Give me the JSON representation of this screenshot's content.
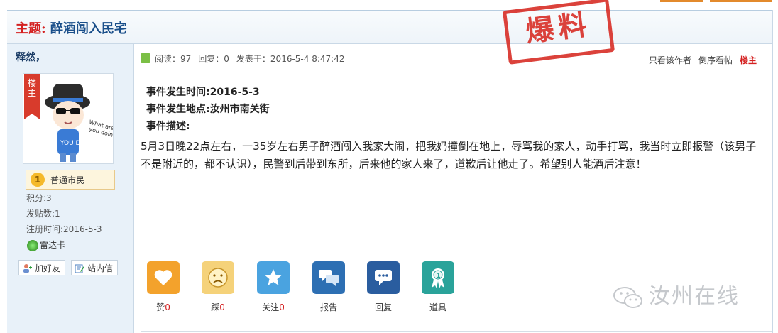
{
  "header": {
    "label": "主题:",
    "title": "醉酒闯入民宅",
    "stamp": "爆料"
  },
  "sidebar": {
    "username": "释然，",
    "ribbon": "楼主",
    "rank": "普通市民",
    "rank_level": "1",
    "points": "积分:3",
    "posts": "发贴数:1",
    "registered": "注册时间:2016-5-3",
    "radar": "雷达卡",
    "add_friend": "加好友",
    "message": "站内信"
  },
  "post": {
    "reads": "阅读：97",
    "replies": "回复：0",
    "posted": "发表于：2016-5-4 8:47:42",
    "only_author": "只看该作者",
    "reverse": "倒序看帖",
    "floor": "楼主",
    "time_line": "事件发生时间:2016-5-3",
    "place_line": "事件发生地点:汝州市南关街",
    "desc_label": "事件描述:",
    "description": " 5月3日晚22点左右，一35岁左右男子醉酒闯入我家大闹，把我妈撞倒在地上，辱骂我的家人，动手打骂，我当时立即报警（该男子不是附近的，都不认识），民警到后带到东所，后来他的家人来了，道歉后让他走了。希望别人能酒后注意！"
  },
  "actions": [
    {
      "label": "赞",
      "count": "0",
      "icon": "heart-icon",
      "color": "#f3a22c"
    },
    {
      "label": "踩",
      "count": "0",
      "icon": "sad-face-icon",
      "color": "#f5d27a"
    },
    {
      "label": "关注",
      "count": "0",
      "icon": "star-icon",
      "color": "#4aa3e0"
    },
    {
      "label": "报告",
      "count": "",
      "icon": "chat-bubbles-icon",
      "color": "#2d6fb3"
    },
    {
      "label": "回复",
      "count": "",
      "icon": "reply-bubble-icon",
      "color": "#2a5d9f"
    },
    {
      "label": "道具",
      "count": "",
      "icon": "medal-icon",
      "color": "#2aa39a"
    }
  ],
  "watermark": "汝州在线"
}
